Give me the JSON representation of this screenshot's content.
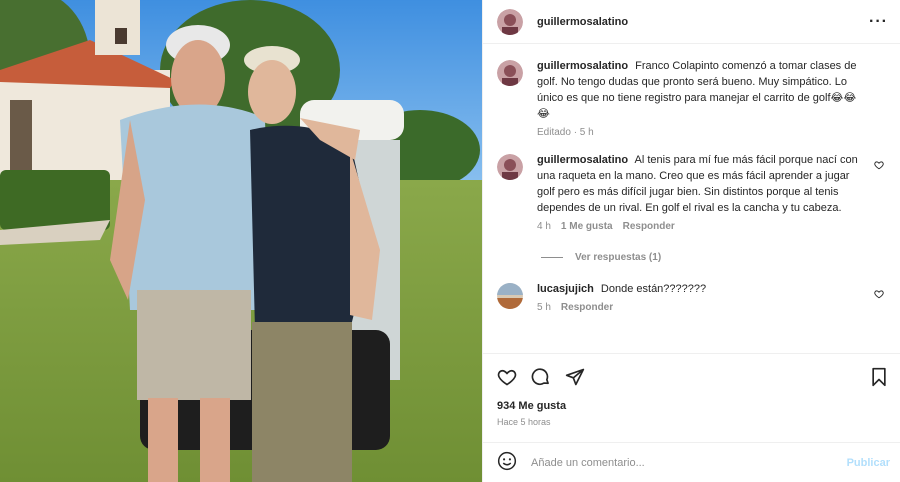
{
  "post": {
    "author": "guillermosalatino",
    "menu_icon": "more-horizontal-icon",
    "photo_alt": "photo"
  },
  "comments": [
    {
      "username": "guillermosalatino",
      "text": "Franco Colapinto comenzó a tomar clases de golf. No tengo dudas que pronto será bueno. Muy simpático. Lo único es que no tiene registro para manejar el carrito de golf😂😂😂",
      "meta_time": "Editado · 5 h"
    },
    {
      "username": "guillermosalatino",
      "text": "Al tenis para mí fue más fácil porque nací con una raqueta en la mano. Creo que es más fácil aprender a jugar golf pero es más difícil jugar bien. Sin distintos porque al tenis dependes de un rival. En golf el rival es la cancha y tu cabeza.",
      "meta_time": "4 h",
      "meta_likes": "1 Me gusta",
      "meta_reply": "Responder",
      "view_replies": "Ver respuestas (1)"
    },
    {
      "username": "lucasjujich",
      "text": "Donde están???????",
      "meta_time": "5 h",
      "meta_reply": "Responder"
    }
  ],
  "actions": {
    "icons": [
      "heart-icon",
      "comment-icon",
      "share-icon",
      "bookmark-icon"
    ]
  },
  "likes_label": "934 Me gusta",
  "timestamp": "Hace 5 horas",
  "composer": {
    "placeholder": "Añade un comentario...",
    "publish_label": "Publicar"
  }
}
